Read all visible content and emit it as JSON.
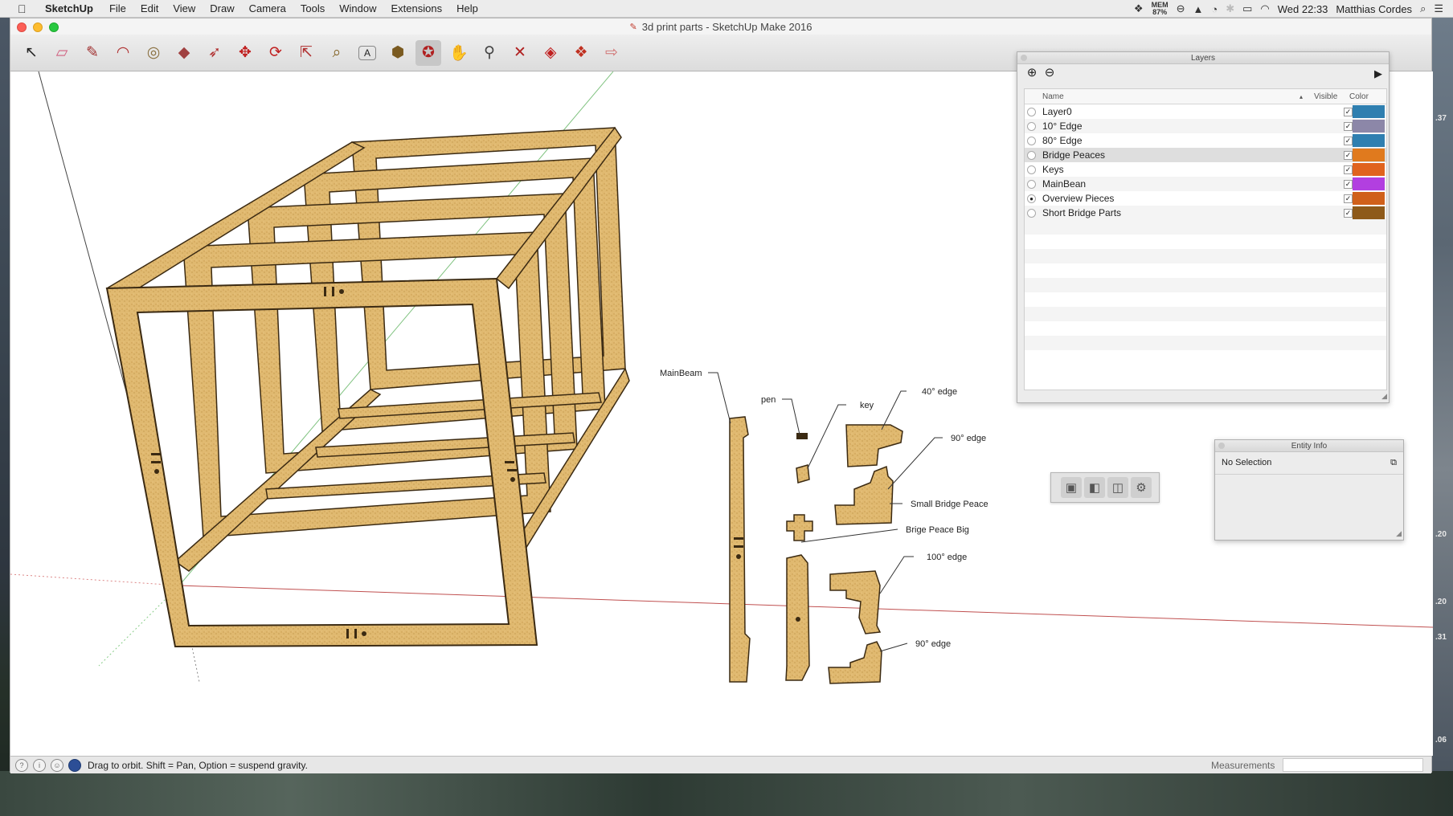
{
  "menubar": {
    "apple": "",
    "app_name": "SketchUp",
    "items": [
      "File",
      "Edit",
      "View",
      "Draw",
      "Camera",
      "Tools",
      "Window",
      "Extensions",
      "Help"
    ],
    "status": {
      "mem_label": "MEM",
      "mem_value": "87%",
      "datetime": "Wed 22:33",
      "user": "Matthias Cordes"
    }
  },
  "window": {
    "title": "3d print parts - SketchUp Make 2016"
  },
  "toolbar": {
    "tools": [
      {
        "name": "select-tool",
        "icon": "↖"
      },
      {
        "name": "eraser-tool",
        "icon": "▱"
      },
      {
        "name": "line-tool",
        "icon": "✎"
      },
      {
        "name": "arc-tool",
        "icon": "◠"
      },
      {
        "name": "shapes-tool",
        "icon": "◎"
      },
      {
        "name": "push-pull-tool",
        "icon": "◆"
      },
      {
        "name": "follow-me-tool",
        "icon": "➶"
      },
      {
        "name": "move-tool",
        "icon": "✥"
      },
      {
        "name": "rotate-tool",
        "icon": "⟳"
      },
      {
        "name": "scale-tool",
        "icon": "⇱"
      },
      {
        "name": "tape-measure-tool",
        "icon": "⌕"
      },
      {
        "name": "text-tool",
        "icon": "A"
      },
      {
        "name": "paint-bucket-tool",
        "icon": "⬢"
      },
      {
        "name": "orbit-tool",
        "icon": "✪"
      },
      {
        "name": "pan-tool",
        "icon": "✋"
      },
      {
        "name": "zoom-tool",
        "icon": "⚲"
      },
      {
        "name": "zoom-extents-tool",
        "icon": "✕"
      },
      {
        "name": "warehouse-tool",
        "icon": "◈"
      },
      {
        "name": "extension-warehouse-tool",
        "icon": "❖"
      },
      {
        "name": "send-to-layout-tool",
        "icon": "⇨"
      }
    ],
    "active_tool": "orbit-tool"
  },
  "callouts": {
    "mainbeam": "MainBeam",
    "pen": "pen",
    "key": "key",
    "edge40": "40° edge",
    "edge90_top": "90° edge",
    "small_bridge": "Small Bridge Peace",
    "bridge_big": "Brige Peace Big",
    "edge100": "100° edge",
    "edge90_bottom": "90° edge"
  },
  "layers_panel": {
    "title": "Layers",
    "columns": {
      "name": "Name",
      "visible": "Visible",
      "color": "Color"
    },
    "rows": [
      {
        "name": "Layer0",
        "visible": "✓",
        "active": false,
        "color": "#2f7fb0"
      },
      {
        "name": "10° Edge",
        "visible": "✓",
        "active": false,
        "color": "#8c87a8"
      },
      {
        "name": "80° Edge",
        "visible": "✓",
        "active": false,
        "color": "#2f7fb0"
      },
      {
        "name": "Bridge Peaces",
        "visible": "✓",
        "active": false,
        "color": "#e07a1e"
      },
      {
        "name": "Keys",
        "visible": "✓",
        "active": false,
        "color": "#e0631e"
      },
      {
        "name": "MainBean",
        "visible": "✓",
        "active": false,
        "color": "#b23fe0"
      },
      {
        "name": "Overview Pieces",
        "visible": "✓",
        "active": true,
        "color": "#d0601a"
      },
      {
        "name": "Short Bridge Parts",
        "visible": "✓",
        "active": false,
        "color": "#8e5a1a"
      }
    ],
    "selected_row": "Bridge Peaces"
  },
  "entity_panel": {
    "title": "Entity Info",
    "selection": "No Selection"
  },
  "statusbar": {
    "hint": "Drag to orbit. Shift = Pan, Option = suspend gravity.",
    "measurements_label": "Measurements",
    "measurements_value": ""
  },
  "right_strip_numbers": [
    ".37",
    ".20",
    ".20",
    ".31",
    ".06"
  ]
}
